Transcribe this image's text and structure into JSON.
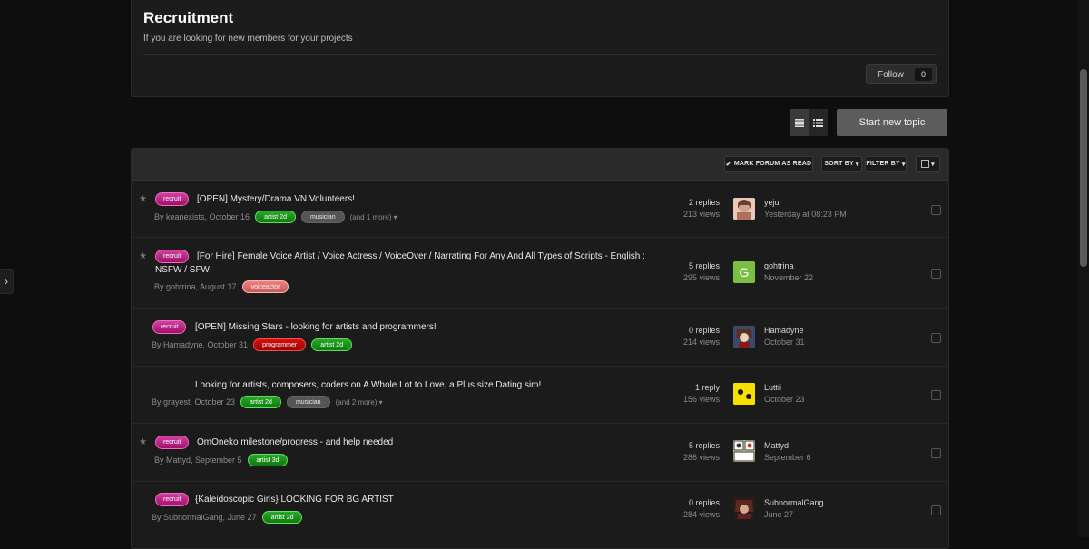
{
  "forum": {
    "title": "Recruitment",
    "description": "If you are looking for new members for your projects",
    "follow_label": "Follow",
    "follow_count": "0"
  },
  "actions": {
    "start_topic": "Start new topic",
    "view_list_icon": "list-view-icon",
    "view_grid_icon": "condensed-view-icon"
  },
  "toolbar": {
    "mark_read": "MARK FORUM AS READ",
    "sort_by": "SORT BY",
    "filter_by": "FILTER BY"
  },
  "topics": [
    {
      "prefix": "recruit",
      "title": "[OPEN] Mystery/Drama VN Volunteers!",
      "author_line": "By keanexists, October 16",
      "tags": [
        {
          "label": "artist 2d",
          "color": "green"
        },
        {
          "label": "musician",
          "color": "gray"
        }
      ],
      "more": "(and 1 more)",
      "replies": "2 replies",
      "views": "213 views",
      "last_user": "yeju",
      "last_date": "Yesterday at 08:23 PM",
      "avatar_icon": "user-avatar-photo-icon"
    },
    {
      "prefix": "recruit",
      "title": "[For Hire] Female Voice Artist / Voice Actress / VoiceOver / Narrating For Any And All Types of Scripts - English : NSFW / SFW",
      "author_line": "By gohtrina, August 17",
      "tags": [
        {
          "label": "voiceactor",
          "color": "pink"
        }
      ],
      "more": "",
      "replies": "5 replies",
      "views": "295 views",
      "last_user": "gohtrina",
      "last_date": "November 22",
      "avatar_letter": "G",
      "avatar_icon": "letter-avatar-icon"
    },
    {
      "prefix": "recruit",
      "title": "[OPEN] Missing Stars - looking for artists and programmers!",
      "author_line": "By Hamadyne, October 31",
      "tags": [
        {
          "label": "programmer",
          "color": "red"
        },
        {
          "label": "artist 2d",
          "color": "green"
        }
      ],
      "more": "",
      "replies": "0 replies",
      "views": "214 views",
      "last_user": "Hamadyne",
      "last_date": "October 31",
      "avatar_icon": "anime-avatar-icon"
    },
    {
      "prefix": "",
      "title": "Looking for artists, composers, coders on A Whole Lot to Love, a Plus size Dating sim!",
      "author_line": "By grayest, October 23",
      "tags": [
        {
          "label": "artist 2d",
          "color": "green"
        },
        {
          "label": "musician",
          "color": "gray"
        }
      ],
      "more": "(and 2 more)",
      "replies": "1 reply",
      "views": "156 views",
      "last_user": "Luttii",
      "last_date": "October 23",
      "avatar_icon": "smiley-face-avatar-icon"
    },
    {
      "prefix": "recruit",
      "title": "OmOneko milestone/progress - and help needed",
      "author_line": "By Mattyd, September 5",
      "tags": [
        {
          "label": "artist 3d",
          "color": "green"
        }
      ],
      "more": "",
      "replies": "5 replies",
      "views": "286 views",
      "last_user": "Mattyd",
      "last_date": "September 6",
      "avatar_icon": "comic-avatar-icon"
    },
    {
      "prefix": "recruit",
      "title": "{Kaleidoscopic Girls} LOOKING FOR BG ARTIST",
      "author_line": "By SubnormalGang, June 27",
      "tags": [
        {
          "label": "artist 2d",
          "color": "green"
        }
      ],
      "more": "",
      "replies": "0 replies",
      "views": "284 views",
      "last_user": "SubnormalGang",
      "last_date": "June 27",
      "avatar_icon": "dark-anime-avatar-icon"
    }
  ],
  "colors": {
    "background": "#0e0e0e",
    "panel": "#1b1b1b",
    "recruit_tag": "#c0278a",
    "tag_green": "#1a9a1a",
    "tag_red": "#cc0000",
    "tag_pink": "#e07070",
    "tag_gray": "#555555"
  }
}
